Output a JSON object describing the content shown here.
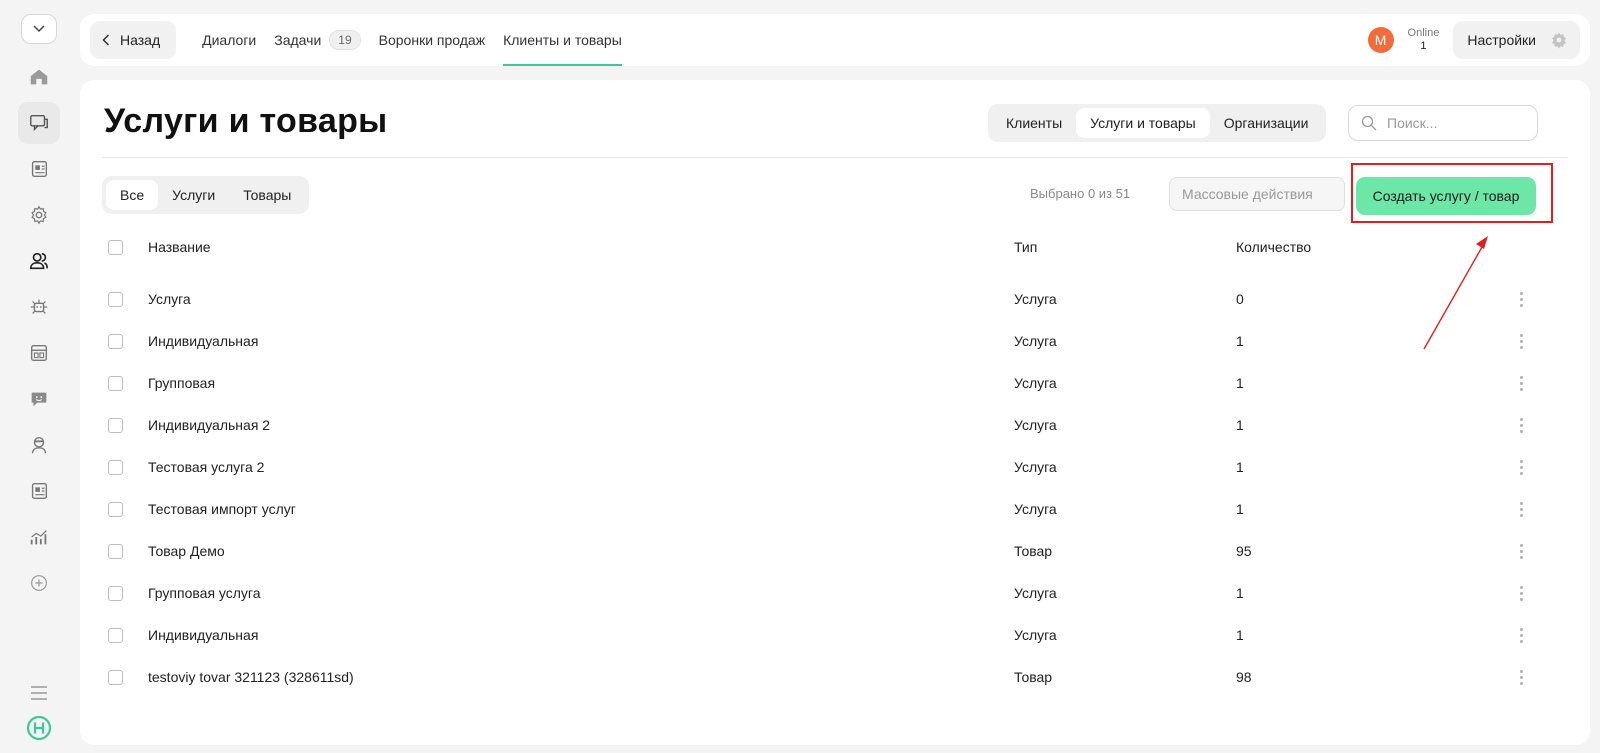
{
  "topbar": {
    "back_label": "Назад",
    "nav": [
      {
        "label": "Диалоги"
      },
      {
        "label": "Задачи",
        "badge": "19"
      },
      {
        "label": "Воронки продаж"
      },
      {
        "label": "Клиенты и товары",
        "active": true
      }
    ],
    "avatar_letter": "M",
    "online_label": "Online",
    "online_count": "1",
    "settings_label": "Настройки"
  },
  "page": {
    "title": "Услуги и товары",
    "tabs": [
      "Клиенты",
      "Услуги и товары",
      "Организации"
    ],
    "active_tab": "Услуги и товары",
    "search_placeholder": "Поиск...",
    "filters": [
      "Все",
      "Услуги",
      "Товары"
    ],
    "active_filter": "Все",
    "selected_count": "Выбрано 0 из 51",
    "mass_actions_placeholder": "Массовые действия",
    "create_button": "Создать услугу / товар"
  },
  "table": {
    "columns": {
      "name": "Название",
      "type": "Тип",
      "qty": "Количество"
    },
    "rows": [
      {
        "name": "Услуга",
        "type": "Услуга",
        "qty": "0"
      },
      {
        "name": "Индивидуальная",
        "type": "Услуга",
        "qty": "1"
      },
      {
        "name": "Групповая",
        "type": "Услуга",
        "qty": "1"
      },
      {
        "name": "Индивидуальная 2",
        "type": "Услуга",
        "qty": "1"
      },
      {
        "name": "Тестовая услуга 2",
        "type": "Услуга",
        "qty": "1"
      },
      {
        "name": "Тестовая импорт услуг",
        "type": "Услуга",
        "qty": "1"
      },
      {
        "name": "Товар Демо",
        "type": "Товар",
        "qty": "95"
      },
      {
        "name": "Групповая услуга",
        "type": "Услуга",
        "qty": "1"
      },
      {
        "name": "Индивидуальная",
        "type": "Услуга",
        "qty": "1"
      },
      {
        "name": "testoviy tovar 321123 (328611sd)",
        "type": "Товар",
        "qty": "98"
      }
    ]
  },
  "colors": {
    "accent": "#3cc89a",
    "create_button_bg": "#6de7a8",
    "avatar_bg": "#f26b3a",
    "annotation": "#e02020"
  },
  "icons": {
    "sidebar": [
      "chevron-down-icon",
      "home-icon",
      "chat-icon",
      "news-icon",
      "gear-icon",
      "clients-icon",
      "bot-icon",
      "dashboard-icon",
      "support-icon",
      "operator-icon",
      "news-icon",
      "analytics-icon",
      "plus-circle-icon"
    ],
    "bottom": [
      "menu-icon",
      "brand-logo-icon"
    ]
  }
}
